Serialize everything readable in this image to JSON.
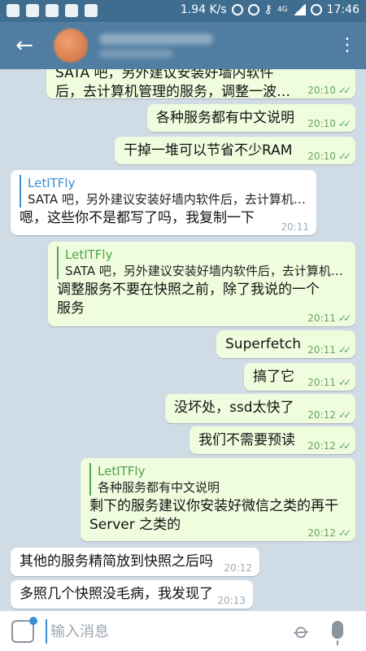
{
  "status_bar": {
    "speed": "1.94 K/s",
    "network": "4G",
    "time": "17:46"
  },
  "header": {
    "back_icon": "arrow-left-icon",
    "menu_icon": "more-vertical-icon"
  },
  "messages": [
    {
      "text": "SATA 吧，另外建议安装好墙内软件后，去计算机管理的服务，调整一波…",
      "time": "20:10",
      "out": true
    },
    {
      "text": "各种服务都有中文说明",
      "time": "20:10",
      "out": true
    },
    {
      "text": "干掉一堆可以节省不少RAM",
      "time": "20:10",
      "out": true
    },
    {
      "reply_name": "LetITFly",
      "reply_text": "SATA 吧，另外建议安装好墙内软件后，去计算机…",
      "text": "嗯，这些你不是都写了吗，我复制一下",
      "time": "20:11",
      "out": false
    },
    {
      "reply_name": "LetITFly",
      "reply_text": "SATA 吧，另外建议安装好墙内软件后，去计算机…",
      "text": "调整服务不要在快照之前，除了我说的一个服务",
      "time": "20:11",
      "out": true
    },
    {
      "text": "Superfetch",
      "time": "20:11",
      "out": true
    },
    {
      "text": "搞了它",
      "time": "20:11",
      "out": true
    },
    {
      "text": "没坏处，ssd太快了",
      "time": "20:12",
      "out": true
    },
    {
      "text": "我们不需要预读",
      "time": "20:12",
      "out": true
    },
    {
      "reply_name": "LetITFly",
      "reply_text": "各种服务都有中文说明",
      "text": "剩下的服务建议你安装好微信之类的再干Server 之类的",
      "time": "20:12",
      "out": true
    },
    {
      "text": "其他的服务精简放到快照之后吗",
      "time": "20:12",
      "out": false
    },
    {
      "text": "多照几个快照没毛病，我发现了",
      "time": "20:13",
      "out": false
    }
  ],
  "input": {
    "placeholder": "输入消息"
  },
  "colors": {
    "header": "#517da2",
    "outgoing_bubble": "#effdde",
    "incoming_bubble": "#ffffff",
    "background": "#cfdbe5"
  }
}
